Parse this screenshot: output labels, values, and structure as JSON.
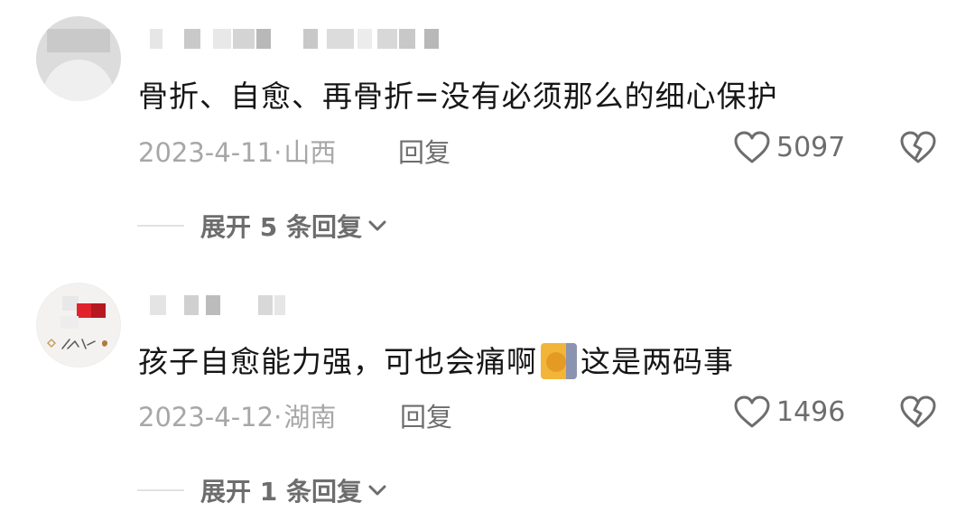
{
  "comments": [
    {
      "text": "骨折、自愈、再骨折=没有必须那么的细心保护",
      "date": "2023-4-11",
      "location": "山西",
      "reply_label": "回复",
      "likes": "5097",
      "expand_label": "展开 5 条回复"
    },
    {
      "text_before": "孩子自愈能力强，可也会痛啊",
      "text_after": "这是两码事",
      "date": "2023-4-12",
      "location": "湖南",
      "reply_label": "回复",
      "likes": "1496",
      "expand_label": "展开 1 条回复"
    }
  ],
  "colors": {
    "text": "#161616",
    "meta": "#a7a7a7",
    "action": "#6d6d6d",
    "background": "#ffffff"
  },
  "icons": {
    "like": "heart-outline-icon",
    "dislike": "broken-heart-icon",
    "expand": "chevron-down-icon",
    "emoji": "cat-peeking-wall-emoji"
  }
}
